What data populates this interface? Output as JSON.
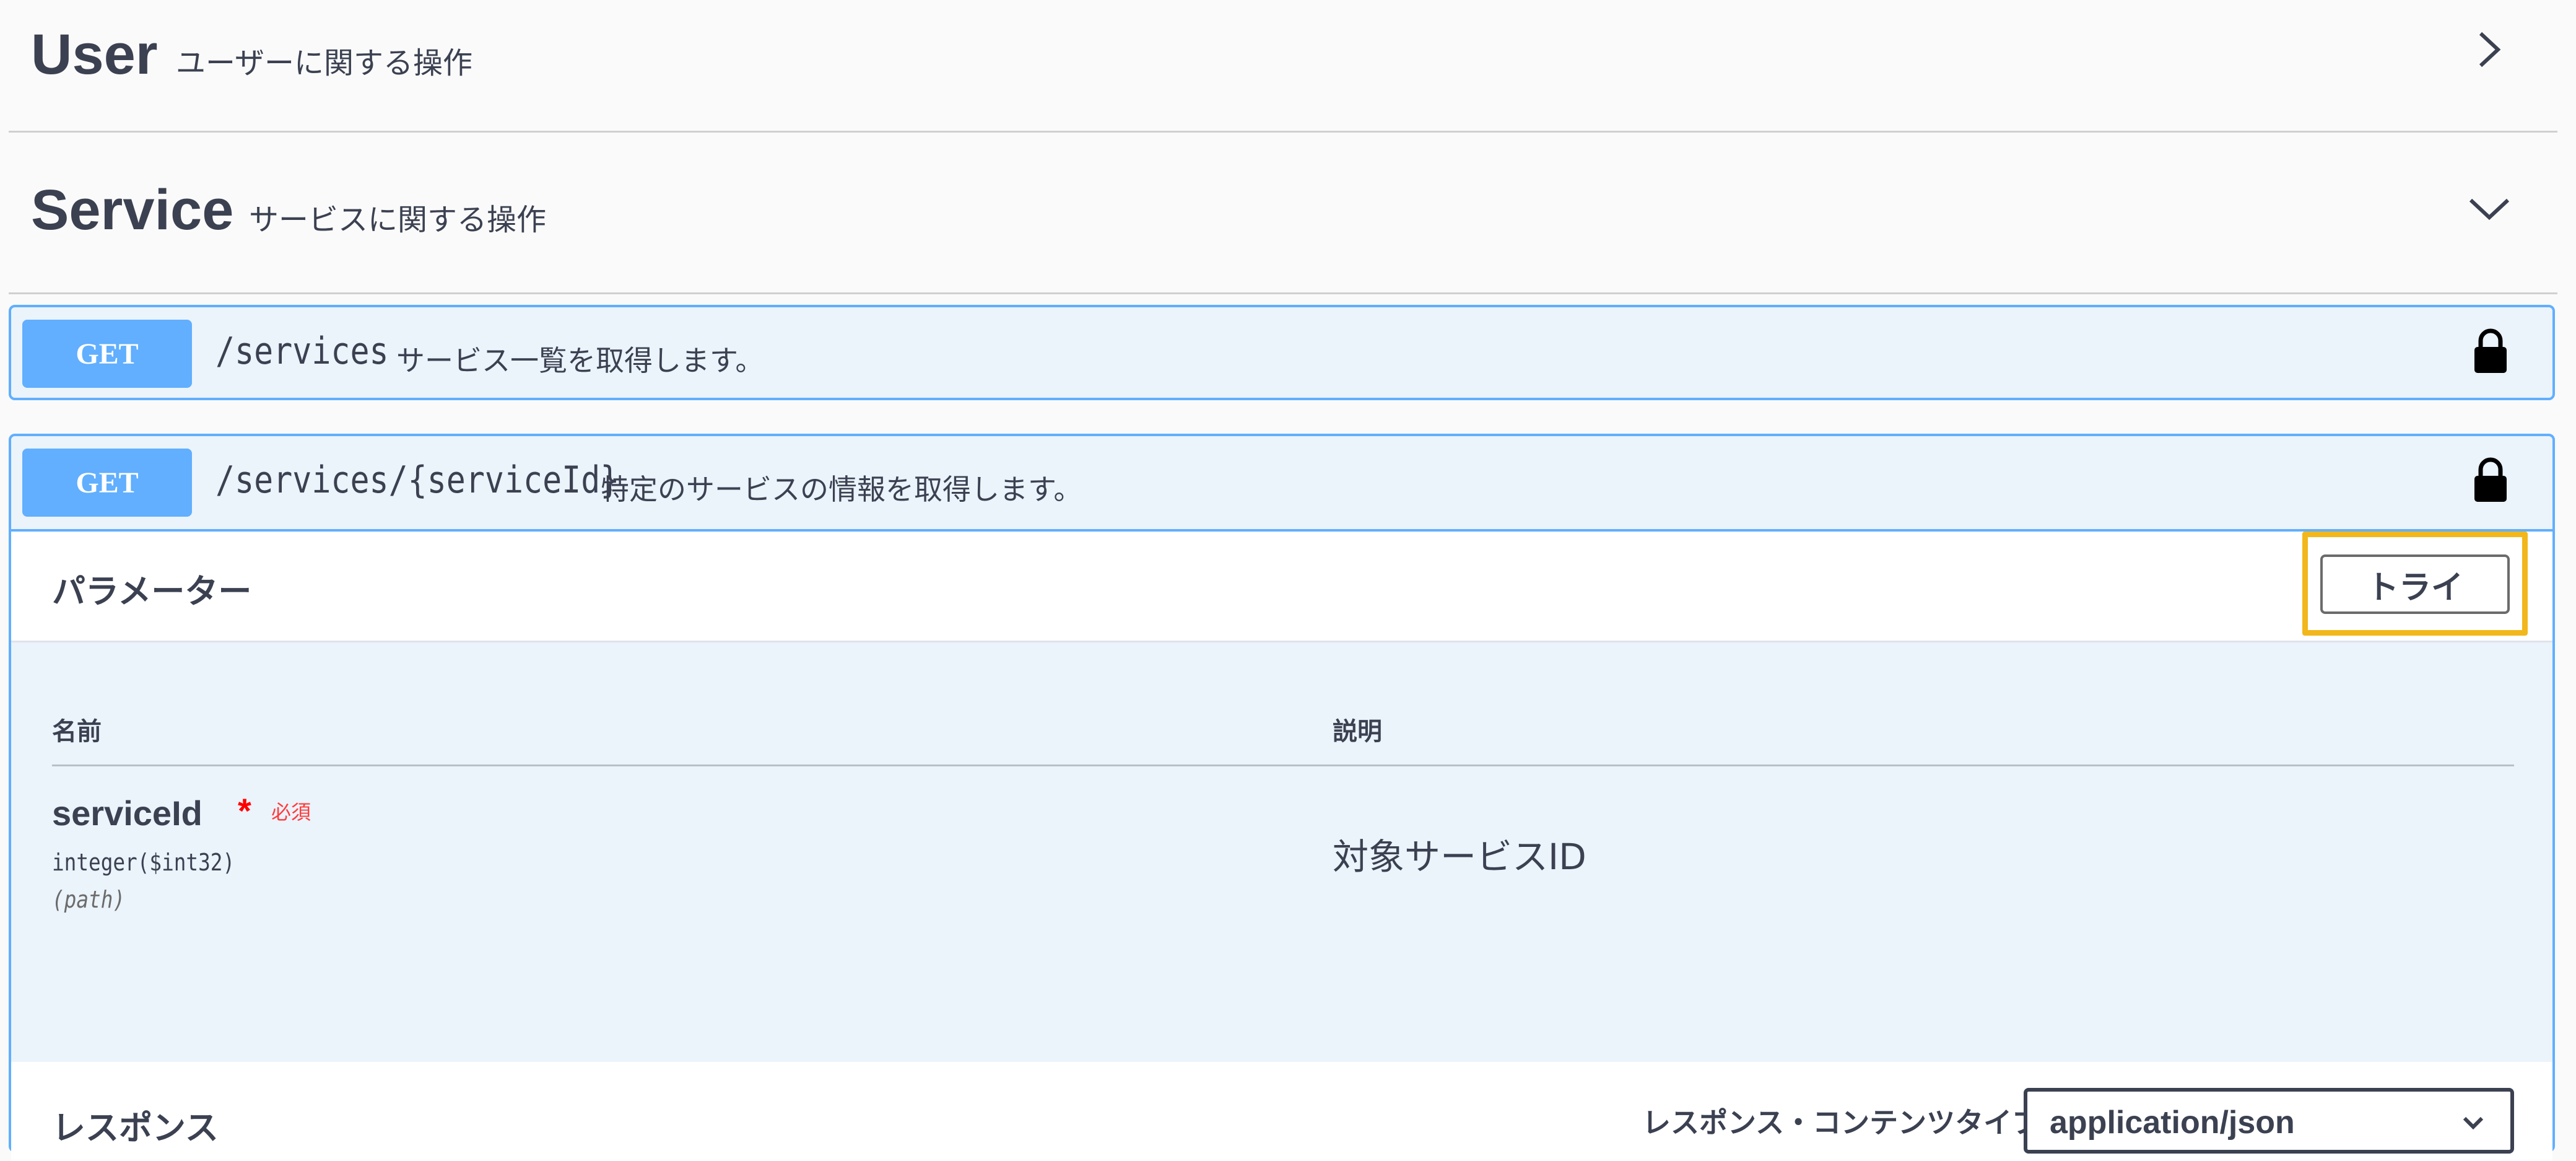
{
  "tags": {
    "user": {
      "name": "User",
      "description": "ユーザーに関する操作"
    },
    "service": {
      "name": "Service",
      "description": "サービスに関する操作"
    }
  },
  "operations": [
    {
      "method": "GET",
      "path": "/services",
      "description": "サービス一覧を取得します。"
    },
    {
      "method": "GET",
      "path": "/services/{serviceId}",
      "description": "特定のサービスの情報を取得します。"
    }
  ],
  "parameters": {
    "title": "パラメーター",
    "try_button": "トライ",
    "column_name": "名前",
    "column_description": "説明",
    "rows": [
      {
        "name": "serviceId",
        "required_star": "*",
        "required_label": "必須",
        "type": "integer($int32)",
        "in": "(path)",
        "description": "対象サービスID"
      }
    ]
  },
  "responses": {
    "title": "レスポンス",
    "content_type_label": "レスポンス・コンテンツタイプ",
    "content_type_value": "application/json"
  },
  "colors": {
    "get_method": "#61affe",
    "get_background": "#ebf3fb",
    "highlight": "#f2b71b",
    "required": "#ff0000"
  },
  "icons": [
    "chevron-right-icon",
    "chevron-down-icon",
    "lock-icon"
  ]
}
